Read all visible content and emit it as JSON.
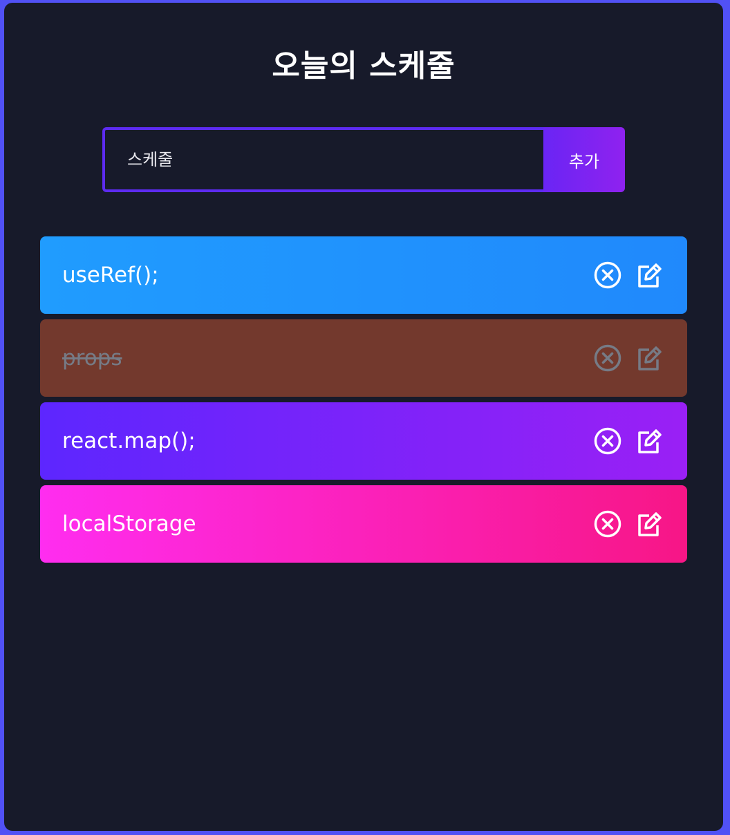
{
  "header": {
    "title": "오늘의 스케줄"
  },
  "form": {
    "input_placeholder": "스케줄",
    "input_value": "",
    "add_label": "추가"
  },
  "todos": [
    {
      "text": "useRef();",
      "complete": false
    },
    {
      "text": "props",
      "complete": true
    },
    {
      "text": "react.map();",
      "complete": false
    },
    {
      "text": "localStorage",
      "complete": false
    }
  ],
  "icons": {
    "delete": "close-circle-icon",
    "edit": "edit-icon"
  },
  "colors": {
    "page_border": "#5151f5",
    "app_background": "#171a2a",
    "input_border": "#5d2bf1",
    "row_blue": "#209cfe",
    "row_complete": "#73392d",
    "row_purple": "#7c24fa",
    "row_pink": "#ff22c8"
  }
}
